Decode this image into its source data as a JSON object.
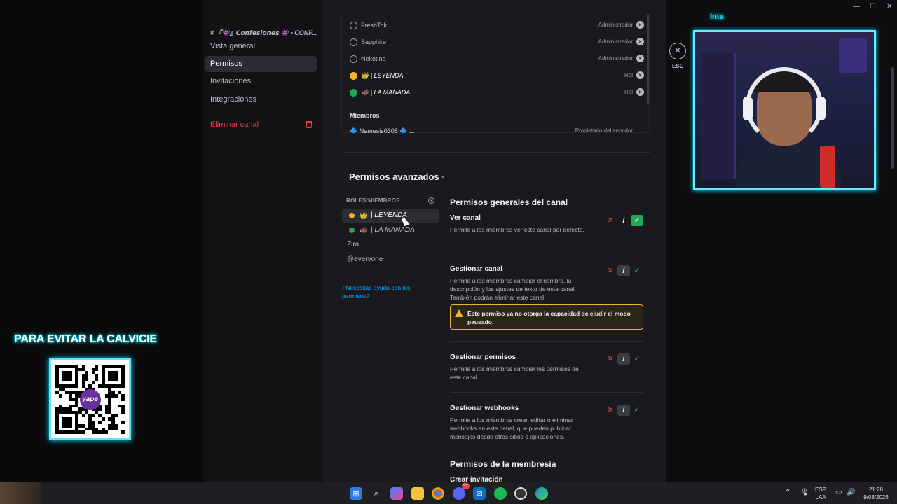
{
  "overlay": {
    "banner_text": "PARA EVITAR LA CALVICIE",
    "qr_logo_text": "yape",
    "cam_label": "lnta"
  },
  "sidebar": {
    "channel_name": "# 『👾』𝘾𝙤𝙣𝙛𝙚𝙨𝙞𝙤𝙣𝙚𝙨 👾 • CONF...",
    "items": [
      {
        "label": "Vista general",
        "active": false
      },
      {
        "label": "Permisos",
        "active": true
      },
      {
        "label": "Invitaciones",
        "active": false
      },
      {
        "label": "Integraciones",
        "active": false
      }
    ],
    "delete_label": "Eliminar canal"
  },
  "access_list": {
    "rows": [
      {
        "name": "FreshTok",
        "role": "Administrador",
        "icon": "user-icon"
      },
      {
        "name": "Sapphire",
        "role": "Administrador",
        "icon": "user-icon"
      },
      {
        "name": "Nekotina",
        "role": "Administrador",
        "icon": "user-icon"
      },
      {
        "name": "👑 | LEYENDA",
        "role": "Rol",
        "icon": "role-yellow-icon"
      },
      {
        "name": "🐗 | LA MANADA",
        "role": "Rol",
        "icon": "role-green-icon"
      }
    ],
    "members_heading": "Miembros",
    "member_partial": "🔷 Nemesis0308 🔷 ...",
    "member_partial_role": "Propietario del servidor"
  },
  "advanced": {
    "title": "Permisos avanzados",
    "roles_heading": "ROLES/MIEMBROS",
    "roles": [
      {
        "emoji": "👑",
        "label": "| LEYENDA",
        "dot": "#f0b232",
        "active": true
      },
      {
        "emoji": "🐗",
        "label": "| LA MANADA",
        "dot": "#23a55a",
        "active": false
      }
    ],
    "plain_roles": [
      "Zira",
      "@everyone"
    ],
    "help_link": "¿Necesitas ayuda con los permisos?"
  },
  "permissions": {
    "general_title": "Permisos generales del canal",
    "items": [
      {
        "title": "Ver canal",
        "desc": "Permite a los miembros ver este canal por defecto.",
        "state": "allow"
      },
      {
        "title": "Gestionar canal",
        "desc": "Permite a los miembros cambiar el nombre, la descripción y los ajustes de texto de este canal. También podrán eliminar este canal.",
        "state": "neutral"
      },
      {
        "title": "Gestionar permisos",
        "desc": "Permite a los miembros cambiar los permisos de este canal.",
        "state": "neutral"
      },
      {
        "title": "Gestionar webhooks",
        "desc": "Permite a los miembros crear, editar o eliminar webhooks en este canal, que pueden publicar mensajes desde otros sitios o aplicaciones.",
        "state": "neutral"
      }
    ],
    "warning": "Este permiso ya no otorga la capacidad de eludir el modo pausado.",
    "membership_title": "Permisos de la membresía",
    "membership_first": "Crear invitación",
    "toggle_deny": "✕",
    "toggle_neutral": "/",
    "toggle_allow": "✓"
  },
  "right_panel": {
    "esc_label": "ESC",
    "close_glyph": "✕"
  },
  "taskbar": {
    "lang_top": "ESP",
    "lang_bottom": "LAA",
    "time": "21:28",
    "date": "9/03/2026",
    "badge": "9+"
  },
  "colors": {
    "accent_green": "#23a55a",
    "danger_red": "#f23f42",
    "warning_yellow": "#f0b232",
    "link_blue": "#00a8fc",
    "neon_cyan": "#00e5ff"
  }
}
